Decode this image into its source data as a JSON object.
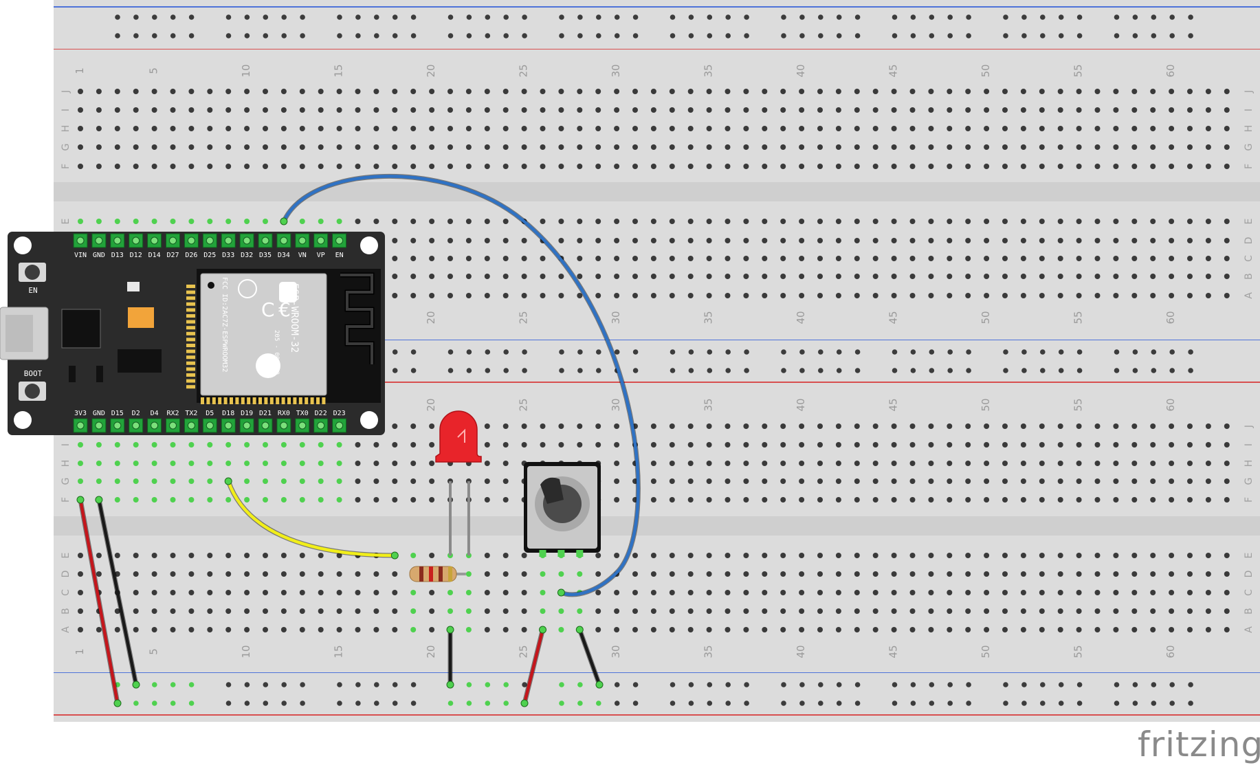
{
  "watermark": "fritzing",
  "breadboard": {
    "columns": 63,
    "column_numbers_shown": [
      "1",
      "5",
      "10",
      "15",
      "20",
      "25",
      "30",
      "35",
      "40",
      "45",
      "50",
      "55",
      "60"
    ],
    "rows_top_block": [
      "J",
      "I",
      "H",
      "G",
      "F"
    ],
    "rows_bottom_block": [
      "E",
      "D",
      "C",
      "B",
      "A"
    ]
  },
  "esp32": {
    "module_label": "ESP-WROOM-32",
    "module_ids": [
      "FCC ID:2AC7Z-ESPWROOM32",
      "205 - 000519"
    ],
    "top_pins": [
      "VIN",
      "GND",
      "D13",
      "D12",
      "D14",
      "D27",
      "D26",
      "D25",
      "D33",
      "D32",
      "D35",
      "D34",
      "VN",
      "VP",
      "EN"
    ],
    "bottom_pins": [
      "3V3",
      "GND",
      "D15",
      "D2",
      "D4",
      "RX2",
      "TX2",
      "D5",
      "D18",
      "D19",
      "D21",
      "RX0",
      "TX0",
      "D22",
      "D23"
    ],
    "buttons": [
      "EN",
      "BOOT"
    ]
  },
  "colors": {
    "board_bg": "#dcdcdc",
    "rail_blue": "#1f4fd8",
    "rail_red": "#d62020",
    "wire_blue": "#2f72c4",
    "wire_yellow": "#f1ee1a",
    "wire_red": "#c4161c",
    "wire_black": "#1a1a1a",
    "led_red": "#e8242a",
    "esp_board": "#2b2b2b"
  }
}
